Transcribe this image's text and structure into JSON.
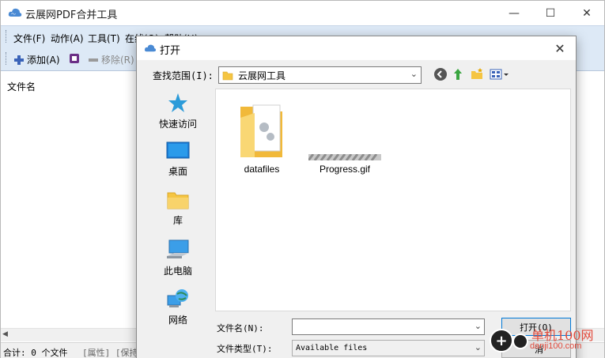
{
  "app": {
    "title": "云展网PDF合并工具",
    "menu": [
      "文件(F)",
      "动作(A)",
      "工具(T)",
      "在线(O)",
      "帮助(H)"
    ],
    "toolbar": {
      "add_label": "添加(A)",
      "remove_label": "移除(R)"
    },
    "list": {
      "column_filename": "文件名"
    },
    "status": {
      "total": "合计: 0 个文件",
      "attr": "[属性] [保持"
    }
  },
  "dialog": {
    "title": "打开",
    "lookin_label": "查找范围(I):",
    "lookin_value": "云展网工具",
    "places": [
      "快速访问",
      "桌面",
      "库",
      "此电脑",
      "网络"
    ],
    "files": [
      {
        "name": "datafiles",
        "icon": "folder-icon"
      },
      {
        "name": "Progress.gif",
        "icon": "gif-progress-icon"
      }
    ],
    "filename_label": "文件名(N):",
    "filename_value": "",
    "filetype_label": "文件类型(T):",
    "filetype_value": "Available files",
    "open_label": "打开(O)",
    "cancel_label": "消"
  },
  "watermark": {
    "line1": "单机100网",
    "line2": "danji100.com"
  },
  "colors": {
    "menubar": "#dde9f6",
    "accent": "#0078d7",
    "folder": "#f5c542"
  }
}
